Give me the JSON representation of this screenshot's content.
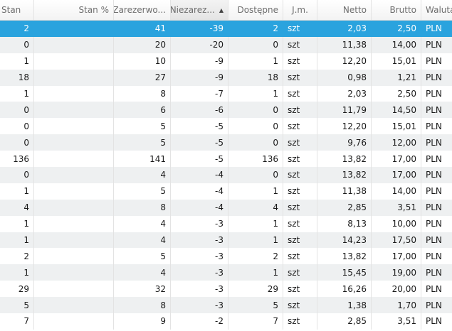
{
  "columns": [
    "Stan",
    "Stan %",
    "Zarezerwo...",
    "Niezarez...",
    "Dostępne",
    "J.m.",
    "Netto",
    "Brutto",
    "Waluta"
  ],
  "sorted_column_index": 3,
  "selected_row_index": 0,
  "colors": {
    "selected_row": "#2aa3de",
    "alternate_row": "#eef0f1"
  },
  "rows": [
    [
      "2",
      "",
      "41",
      "-39",
      "2",
      "szt",
      "2,03",
      "2,50",
      "PLN"
    ],
    [
      "0",
      "",
      "20",
      "-20",
      "0",
      "szt",
      "11,38",
      "14,00",
      "PLN"
    ],
    [
      "1",
      "",
      "10",
      "-9",
      "1",
      "szt",
      "12,20",
      "15,01",
      "PLN"
    ],
    [
      "18",
      "",
      "27",
      "-9",
      "18",
      "szt",
      "0,98",
      "1,21",
      "PLN"
    ],
    [
      "1",
      "",
      "8",
      "-7",
      "1",
      "szt",
      "2,03",
      "2,50",
      "PLN"
    ],
    [
      "0",
      "",
      "6",
      "-6",
      "0",
      "szt",
      "11,79",
      "14,50",
      "PLN"
    ],
    [
      "0",
      "",
      "5",
      "-5",
      "0",
      "szt",
      "12,20",
      "15,01",
      "PLN"
    ],
    [
      "0",
      "",
      "5",
      "-5",
      "0",
      "szt",
      "9,76",
      "12,00",
      "PLN"
    ],
    [
      "136",
      "",
      "141",
      "-5",
      "136",
      "szt",
      "13,82",
      "17,00",
      "PLN"
    ],
    [
      "0",
      "",
      "4",
      "-4",
      "0",
      "szt",
      "13,82",
      "17,00",
      "PLN"
    ],
    [
      "1",
      "",
      "5",
      "-4",
      "1",
      "szt",
      "11,38",
      "14,00",
      "PLN"
    ],
    [
      "4",
      "",
      "8",
      "-4",
      "4",
      "szt",
      "2,85",
      "3,51",
      "PLN"
    ],
    [
      "1",
      "",
      "4",
      "-3",
      "1",
      "szt",
      "8,13",
      "10,00",
      "PLN"
    ],
    [
      "1",
      "",
      "4",
      "-3",
      "1",
      "szt",
      "14,23",
      "17,50",
      "PLN"
    ],
    [
      "2",
      "",
      "5",
      "-3",
      "2",
      "szt",
      "13,82",
      "17,00",
      "PLN"
    ],
    [
      "1",
      "",
      "4",
      "-3",
      "1",
      "szt",
      "15,45",
      "19,00",
      "PLN"
    ],
    [
      "29",
      "",
      "32",
      "-3",
      "29",
      "szt",
      "16,26",
      "20,00",
      "PLN"
    ],
    [
      "5",
      "",
      "8",
      "-3",
      "5",
      "szt",
      "1,38",
      "1,70",
      "PLN"
    ],
    [
      "7",
      "",
      "9",
      "-2",
      "7",
      "szt",
      "2,85",
      "3,51",
      "PLN"
    ]
  ]
}
